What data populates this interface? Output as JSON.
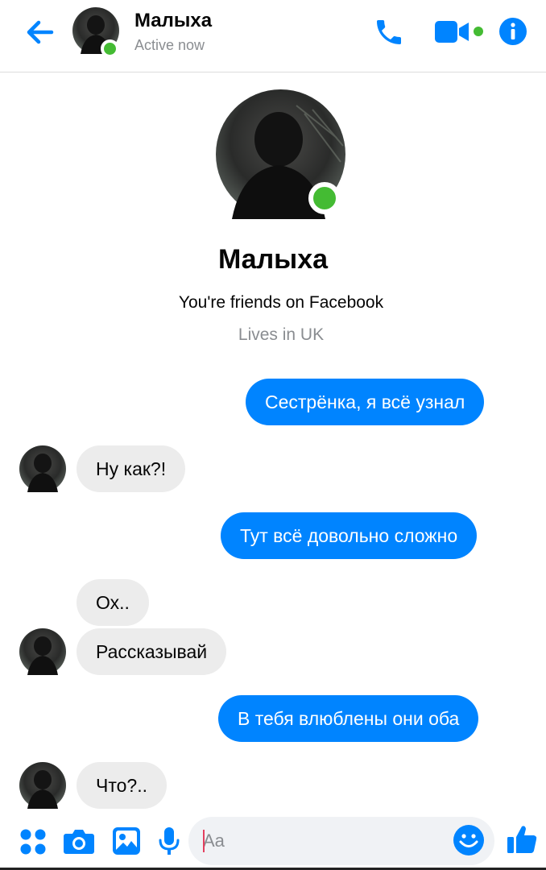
{
  "header": {
    "contact_name": "Малыха",
    "status": "Active now"
  },
  "profile": {
    "name": "Малыха",
    "friends_text": "You're friends on Facebook",
    "lives_text": "Lives in UK"
  },
  "messages": [
    {
      "direction": "outgoing",
      "text": "Сестрёнка, я всё узнал"
    },
    {
      "direction": "incoming",
      "text": "Ну как?!"
    },
    {
      "direction": "outgoing",
      "text": "Тут всё довольно сложно"
    },
    {
      "direction": "incoming",
      "text": "Ох.."
    },
    {
      "direction": "incoming",
      "text": "Рассказывай"
    },
    {
      "direction": "outgoing",
      "text": "В тебя влюблены они оба"
    },
    {
      "direction": "incoming",
      "text": "Что?.."
    }
  ],
  "composer": {
    "placeholder": "Aa"
  },
  "icons": {
    "back": "back-arrow-icon",
    "call": "phone-icon",
    "video": "video-camera-icon",
    "info": "info-icon",
    "menu": "four-dots-icon",
    "camera": "camera-icon",
    "gallery": "image-icon",
    "mic": "microphone-icon",
    "emoji": "smiley-icon",
    "like": "thumbs-up-icon"
  },
  "colors": {
    "accent": "#0084ff",
    "online": "#44bb33",
    "incoming_bubble": "#ececec",
    "muted_text": "#8a8d91"
  }
}
